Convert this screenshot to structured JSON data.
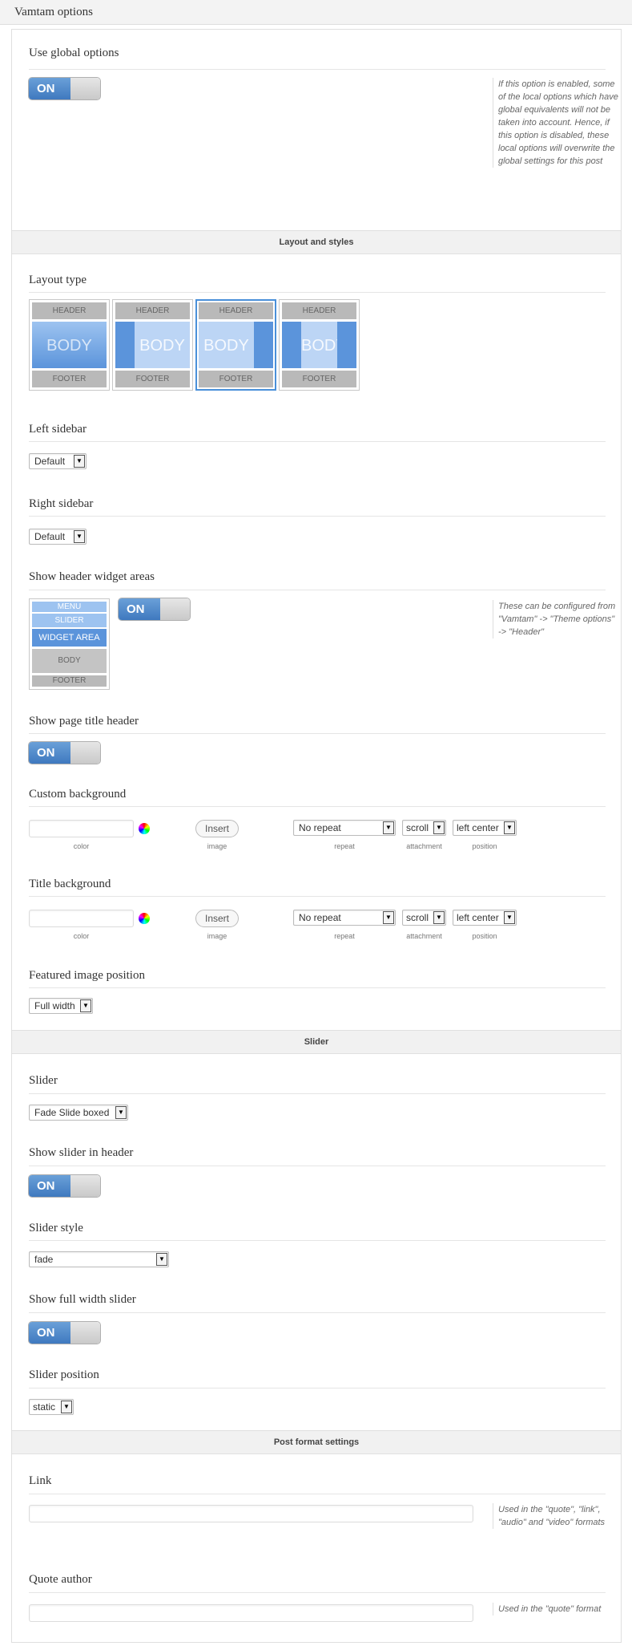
{
  "metabox": {
    "title": "Vamtam options"
  },
  "global_options": {
    "label": "Use global options",
    "toggle": "ON",
    "description": "If this option is enabled, some of the local options which have global equivalents will not be taken into account. Hence, if this option is disabled, these local options will overwrite the global settings for this post"
  },
  "sections": {
    "layout": "Layout and styles",
    "slider": "Slider",
    "post_format": "Post format settings"
  },
  "layout_type": {
    "label": "Layout type",
    "header": "HEADER",
    "body": "BODY",
    "footer": "FOOTER",
    "selected_index": 2
  },
  "left_sidebar": {
    "label": "Left sidebar",
    "value": "Default"
  },
  "right_sidebar": {
    "label": "Right sidebar",
    "value": "Default"
  },
  "header_widget": {
    "label": "Show header widget areas",
    "toggle": "ON",
    "menu": "MENU",
    "slider": "SLIDER",
    "widget_area": "WIDGET AREA",
    "body": "BODY",
    "footer": "FOOTER",
    "description": "These can be configured from \"Vamtam\" -> \"Theme options\" -> \"Header\""
  },
  "page_title": {
    "label": "Show page title header",
    "toggle": "ON"
  },
  "custom_background": {
    "label": "Custom background",
    "color_label": "color",
    "insert": "Insert",
    "image_label": "image",
    "repeat_value": "No repeat",
    "repeat_label": "repeat",
    "attachment_value": "scroll",
    "attachment_label": "attachment",
    "position_value": "left center",
    "position_label": "position"
  },
  "title_background": {
    "label": "Title background",
    "color_label": "color",
    "insert": "Insert",
    "image_label": "image",
    "repeat_value": "No repeat",
    "repeat_label": "repeat",
    "attachment_value": "scroll",
    "attachment_label": "attachment",
    "position_value": "left center",
    "position_label": "position"
  },
  "featured_image": {
    "label": "Featured image position",
    "value": "Full width"
  },
  "slider": {
    "label": "Slider",
    "value": "Fade Slide boxed"
  },
  "slider_in_header": {
    "label": "Show slider in header",
    "toggle": "ON"
  },
  "slider_style": {
    "label": "Slider style",
    "value": "fade"
  },
  "full_width_slider": {
    "label": "Show full width slider",
    "toggle": "ON"
  },
  "slider_position": {
    "label": "Slider position",
    "value": "static"
  },
  "link": {
    "label": "Link",
    "value": "",
    "description": "Used in the \"quote\", \"link\", \"audio\" and \"video\" formats"
  },
  "quote_author": {
    "label": "Quote author",
    "value": "",
    "description": "Used in the \"quote\" format"
  },
  "colors": {
    "accent": "#4a90d9",
    "toggle_on": "#3f79bf"
  }
}
